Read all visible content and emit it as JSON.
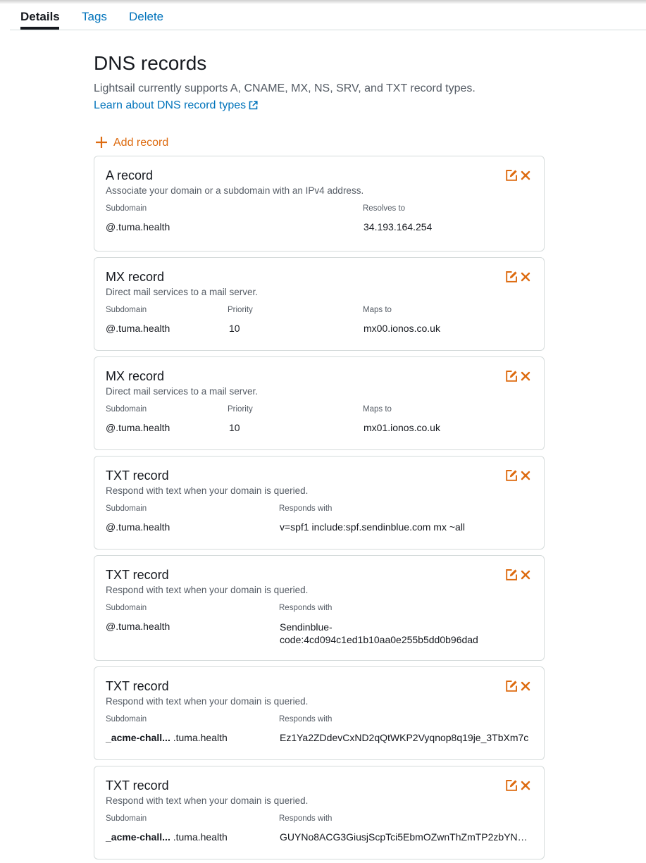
{
  "tabs": [
    {
      "label": "Details",
      "active": true
    },
    {
      "label": "Tags",
      "active": false
    },
    {
      "label": "Delete",
      "active": false
    }
  ],
  "dns": {
    "title": "DNS records",
    "subtitle": "Lightsail currently supports A, CNAME, MX, NS, SRV, and TXT record types.",
    "learn_link": "Learn about DNS record types",
    "add_record": "Add record"
  },
  "icons": {
    "edit": "edit-icon",
    "delete": "close-icon",
    "add": "plus-icon",
    "external": "external-link-icon"
  },
  "colors": {
    "accent": "#dd6b10",
    "link": "#0073bb",
    "text": "#16191f",
    "muted": "#545b64",
    "border": "#d5dbdb"
  },
  "records": [
    {
      "title": "A record",
      "description": "Associate your domain or a subdomain with an IPv4 address.",
      "subdomain_label": "Subdomain",
      "subdomain_prefix": "@",
      "subdomain_domain": ".tuma.health",
      "target_label": "Resolves to",
      "target_value": "34.193.164.254"
    },
    {
      "title": "MX record",
      "description": "Direct mail services to a mail server.",
      "subdomain_label": "Subdomain",
      "subdomain_prefix": "@",
      "subdomain_domain": ".tuma.health",
      "priority_label": "Priority",
      "priority_value": "10",
      "target_label": "Maps to",
      "target_value": "mx00.ionos.co.uk"
    },
    {
      "title": "MX record",
      "description": "Direct mail services to a mail server.",
      "subdomain_label": "Subdomain",
      "subdomain_prefix": "@",
      "subdomain_domain": ".tuma.health",
      "priority_label": "Priority",
      "priority_value": "10",
      "target_label": "Maps to",
      "target_value": "mx01.ionos.co.uk"
    },
    {
      "title": "TXT record",
      "description": "Respond with text when your domain is queried.",
      "subdomain_label": "Subdomain",
      "subdomain_prefix": "@",
      "subdomain_domain": ".tuma.health",
      "target_label": "Responds with",
      "target_value": "v=spf1 include:spf.sendinblue.com mx ~all"
    },
    {
      "title": "TXT record",
      "description": "Respond with text when your domain is queried.",
      "subdomain_label": "Subdomain",
      "subdomain_prefix": "@",
      "subdomain_domain": ".tuma.health",
      "target_label": "Responds with",
      "target_value": "Sendinblue-code:4cd094c1ed1b10aa0e255b5dd0b96dad"
    },
    {
      "title": "TXT record",
      "description": "Respond with text when your domain is queried.",
      "subdomain_label": "Subdomain",
      "subdomain_prefix": "_acme-chall...",
      "subdomain_domain": " .tuma.health",
      "target_label": "Responds with",
      "target_value": "Ez1Ya2ZDdevCxND2qQtWKP2Vyqnop8q19je_3TbXm7c"
    },
    {
      "title": "TXT record",
      "description": "Respond with text when your domain is queried.",
      "subdomain_label": "Subdomain",
      "subdomain_prefix": "_acme-chall...",
      "subdomain_domain": " .tuma.health",
      "target_label": "Responds with",
      "target_value": "GUYNo8ACG3GiusjScpTci5EbmOZwnThZmTP2zbYNO..."
    }
  ]
}
